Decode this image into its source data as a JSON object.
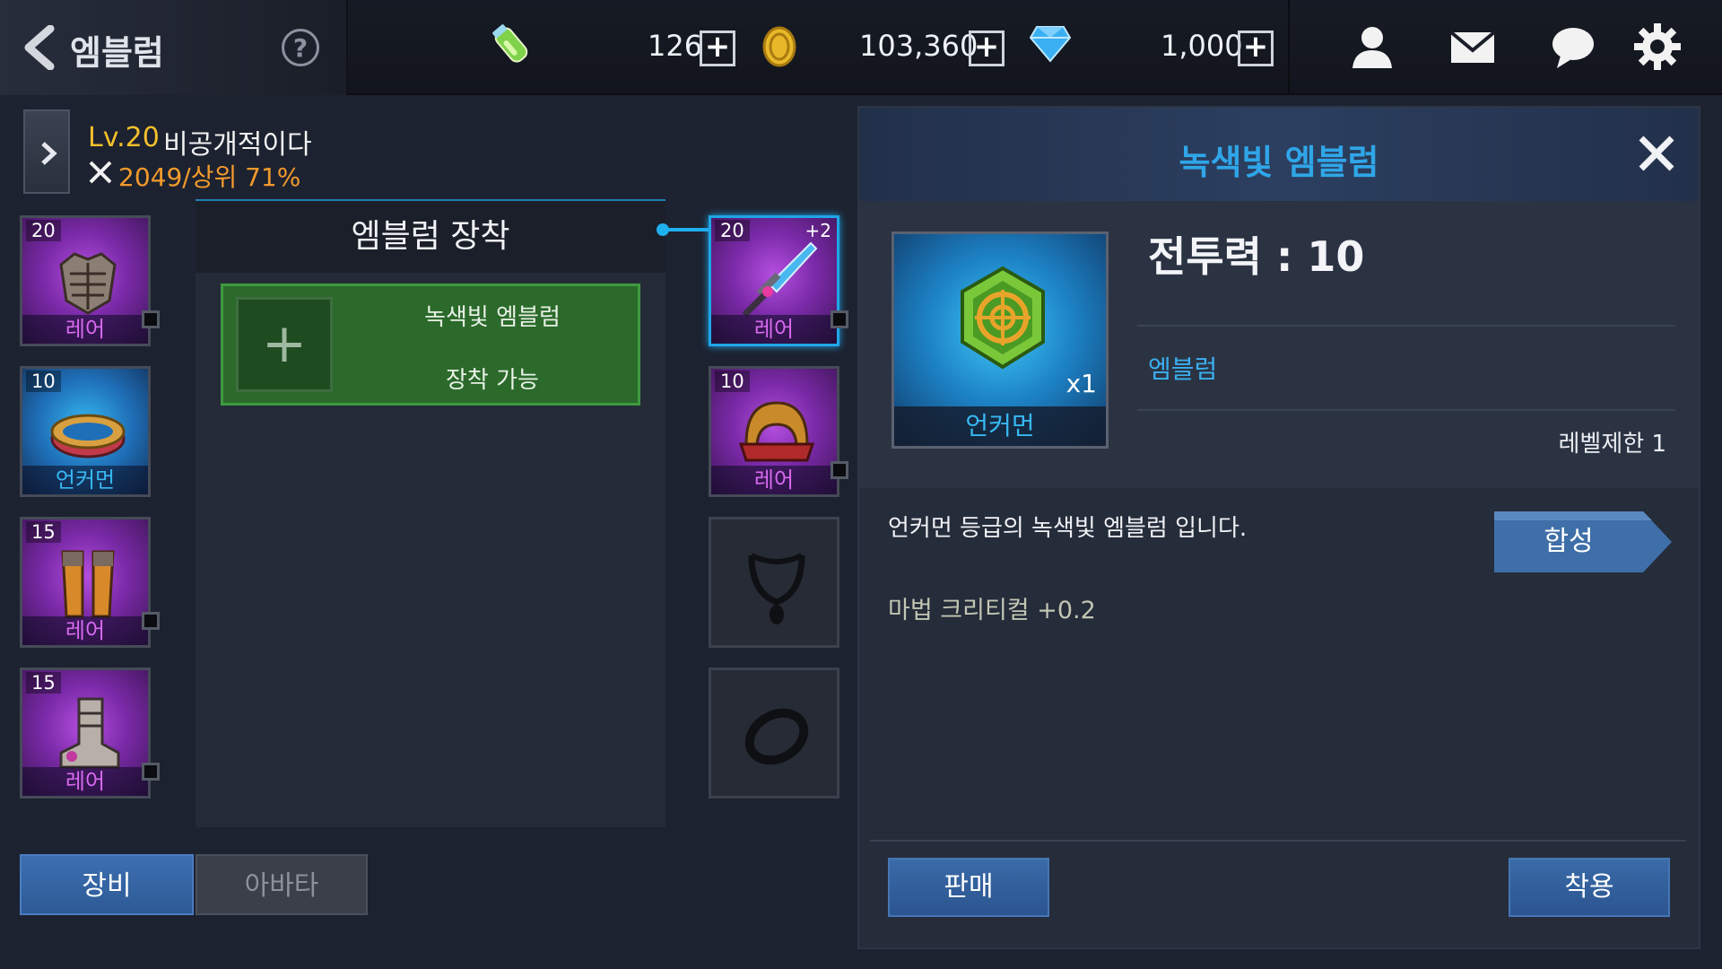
{
  "header": {
    "title": "엠블럼",
    "help_label": "?",
    "resources": {
      "energy": "126",
      "gold": "103,360",
      "gems": "1,000",
      "plus_label": "+"
    },
    "icons": [
      "back-arrow-icon",
      "help-icon",
      "potion-icon",
      "gold-coin-icon",
      "gem-icon",
      "friends-icon",
      "mail-icon",
      "chat-icon",
      "settings-gear-icon"
    ]
  },
  "character": {
    "level": "Lv.20",
    "name": "비공개적이다",
    "power": "2049/상위 71%"
  },
  "equipment_left": [
    {
      "level": "20",
      "grade": "레어",
      "item": "chest-armor"
    },
    {
      "level": "10",
      "grade": "언커먼",
      "item": "belt"
    },
    {
      "level": "15",
      "grade": "레어",
      "item": "leg-armor"
    },
    {
      "level": "15",
      "grade": "레어",
      "item": "boots"
    }
  ],
  "equipment_right": [
    {
      "level": "20",
      "enhance": "+2",
      "grade": "레어",
      "item": "dagger",
      "selected": true
    },
    {
      "level": "10",
      "grade": "레어",
      "item": "helmet"
    },
    {
      "level": "",
      "grade": "",
      "item": "necklace-empty"
    },
    {
      "level": "",
      "grade": "",
      "item": "ring-empty"
    }
  ],
  "emblem_panel": {
    "title": "엠블럼 장착",
    "slot_plus": "+",
    "slot_name": "녹색빛 엠블럼",
    "slot_status": "장착 가능"
  },
  "tabs": {
    "equipment": "장비",
    "avatar": "아바타"
  },
  "detail": {
    "title": "녹색빛 엠블럼",
    "item_grade": "언커먼",
    "quantity": "x1",
    "combat_power": "전투력 : 10",
    "item_type": "엠블럼",
    "level_req": "레벨제한 1",
    "description": "언커먼 등급의 녹색빛 엠블럼 입니다.",
    "stat": "마법 크리티컬 +0.2",
    "synth_label": "합성",
    "sell_label": "판매",
    "equip_label": "착용"
  },
  "colors": {
    "background": "#1d2230",
    "accent_blue": "#1fa6e6",
    "rare_purple": "#d86af0",
    "uncommon_blue": "#38b8f2",
    "level_gold": "#f2c02a",
    "power_orange": "#f19a2c",
    "emblem_green": "#2b6a2b"
  }
}
